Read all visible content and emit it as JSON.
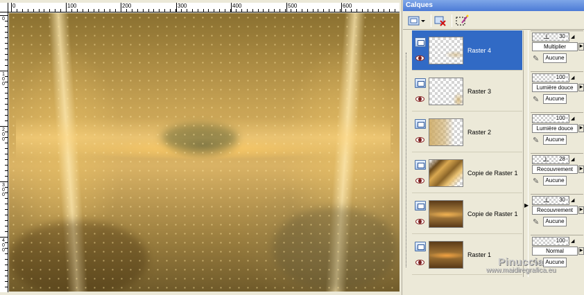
{
  "window": {
    "palette_title": "Calques"
  },
  "ruler": {
    "horizontal_labels": [
      "0",
      "100",
      "200",
      "300",
      "400",
      "500",
      "600"
    ],
    "vertical_labels": [
      "0",
      "1\n0\n0",
      "2\n0\n0",
      "3\n0\n0",
      "4\n0\n0"
    ]
  },
  "layers": [
    {
      "name": "Raster 4",
      "selected": true,
      "opacity": 30,
      "blend": "Multiplier",
      "mask": "Aucune"
    },
    {
      "name": "Raster 3",
      "selected": false,
      "opacity": 100,
      "blend": "Lumière douce",
      "mask": "Aucune"
    },
    {
      "name": "Raster 2",
      "selected": false,
      "opacity": 100,
      "blend": "Lumière douce",
      "mask": "Aucune"
    },
    {
      "name": "Copie de Raster 1",
      "selected": false,
      "opacity": 28,
      "blend": "Recouvrement",
      "mask": "Aucune"
    },
    {
      "name": "Copie de Raster 1",
      "selected": false,
      "opacity": 30,
      "blend": "Recouvrement",
      "mask": "Aucune"
    },
    {
      "name": "Raster 1",
      "selected": false,
      "opacity": 100,
      "blend": "Normal",
      "mask": "Aucune"
    }
  ],
  "watermark": {
    "name": "Pinuccia",
    "url": "www.maidiregrafica.eu"
  },
  "colors": {
    "selection": "#316ac5",
    "titlebar": "#4c7bd6"
  }
}
